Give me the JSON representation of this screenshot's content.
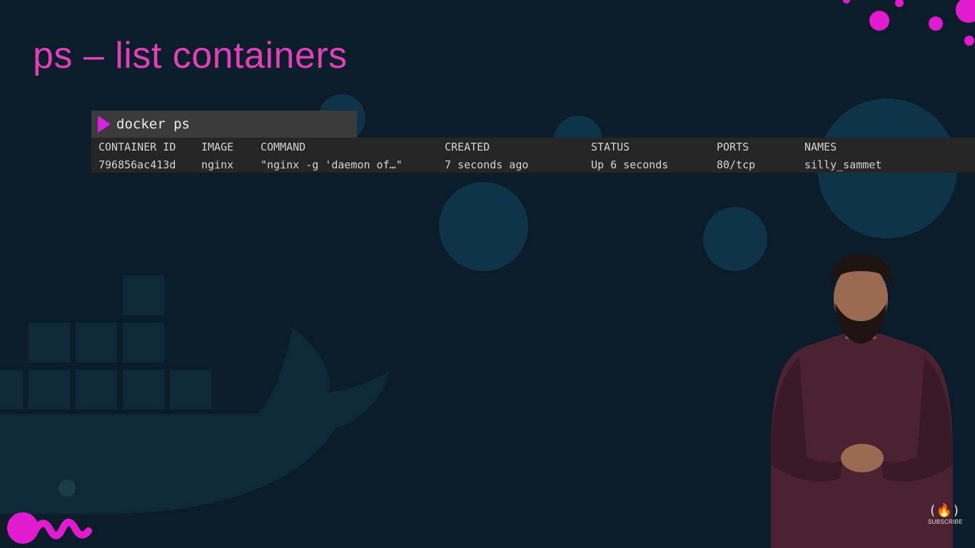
{
  "slide": {
    "title": "ps – list containers"
  },
  "terminal": {
    "prompt_command": "docker ps",
    "headers": {
      "container_id": "CONTAINER ID",
      "image": "IMAGE",
      "command": "COMMAND",
      "created": "CREATED",
      "status": "STATUS",
      "ports": "PORTS",
      "names": "NAMES"
    },
    "rows": [
      {
        "container_id": "796856ac413d",
        "image": "nginx",
        "command": "\"nginx -g 'daemon of…\"",
        "created": "7 seconds ago",
        "status": "Up 6 seconds",
        "ports": "80/tcp",
        "names": "silly_sammet"
      }
    ]
  },
  "channel_logo": {
    "glyph": "(🔥)",
    "label": "SUBSCRIBE"
  },
  "colors": {
    "background": "#0b1d2b",
    "title_pink": "#e23fb8",
    "accent_magenta": "#d822e0",
    "prompt_bar": "#3b3b3b",
    "terminal_bg": "#262626",
    "decor_circle": "#0f3447"
  }
}
